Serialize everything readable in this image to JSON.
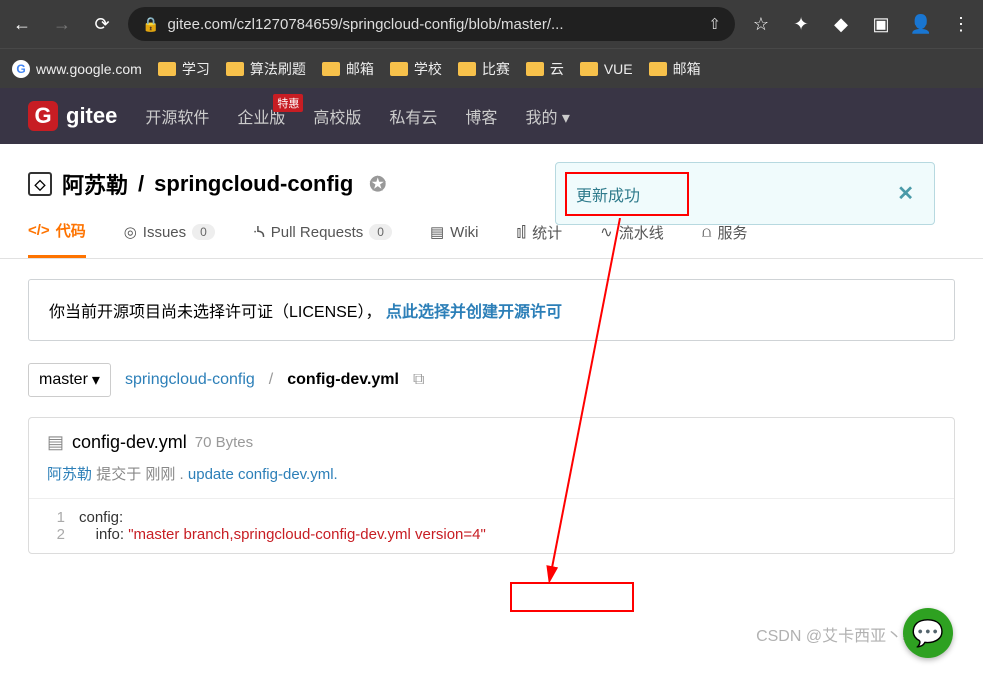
{
  "browser": {
    "url": "gitee.com/czl1270784659/springcloud-config/blob/master/..."
  },
  "bookmarks": [
    {
      "type": "site",
      "label": "www.google.com"
    },
    {
      "type": "folder",
      "label": "学习"
    },
    {
      "type": "folder",
      "label": "算法刷题"
    },
    {
      "type": "folder",
      "label": "邮箱"
    },
    {
      "type": "folder",
      "label": "学校"
    },
    {
      "type": "folder",
      "label": "比赛"
    },
    {
      "type": "folder",
      "label": "云"
    },
    {
      "type": "folder",
      "label": "VUE"
    },
    {
      "type": "folder",
      "label": "邮箱"
    }
  ],
  "nav": {
    "logo": "gitee",
    "items": [
      "开源软件",
      "企业版",
      "高校版",
      "私有云",
      "博客",
      "我的"
    ],
    "badge": "特惠"
  },
  "repo": {
    "owner": "阿苏勒",
    "name": "springcloud-config"
  },
  "toast": {
    "text": "更新成功"
  },
  "tabs": {
    "code": "代码",
    "issues": {
      "label": "Issues",
      "count": "0"
    },
    "pr": {
      "label": "Pull Requests",
      "count": "0"
    },
    "wiki": "Wiki",
    "stats": "统计",
    "pipeline": "流水线",
    "service": "服务"
  },
  "license": {
    "prefix": "你当前开源项目尚未选择许可证（LICENSE），",
    "link": "点此选择并创建开源许可"
  },
  "branch": "master",
  "path": {
    "repo": "springcloud-config",
    "file": "config-dev.yml"
  },
  "file": {
    "name": "config-dev.yml",
    "size": "70 Bytes",
    "author": "阿苏勒",
    "commit_prefix": "提交于",
    "time": "刚刚",
    "msg": "update config-dev.yml."
  },
  "code": {
    "l1": "config:",
    "l2_key": "    info: ",
    "l2_val": "\"master branch,springcloud-config-dev.yml version=4\""
  },
  "watermark": "CSDN @艾卡西亚丶暴雨L"
}
